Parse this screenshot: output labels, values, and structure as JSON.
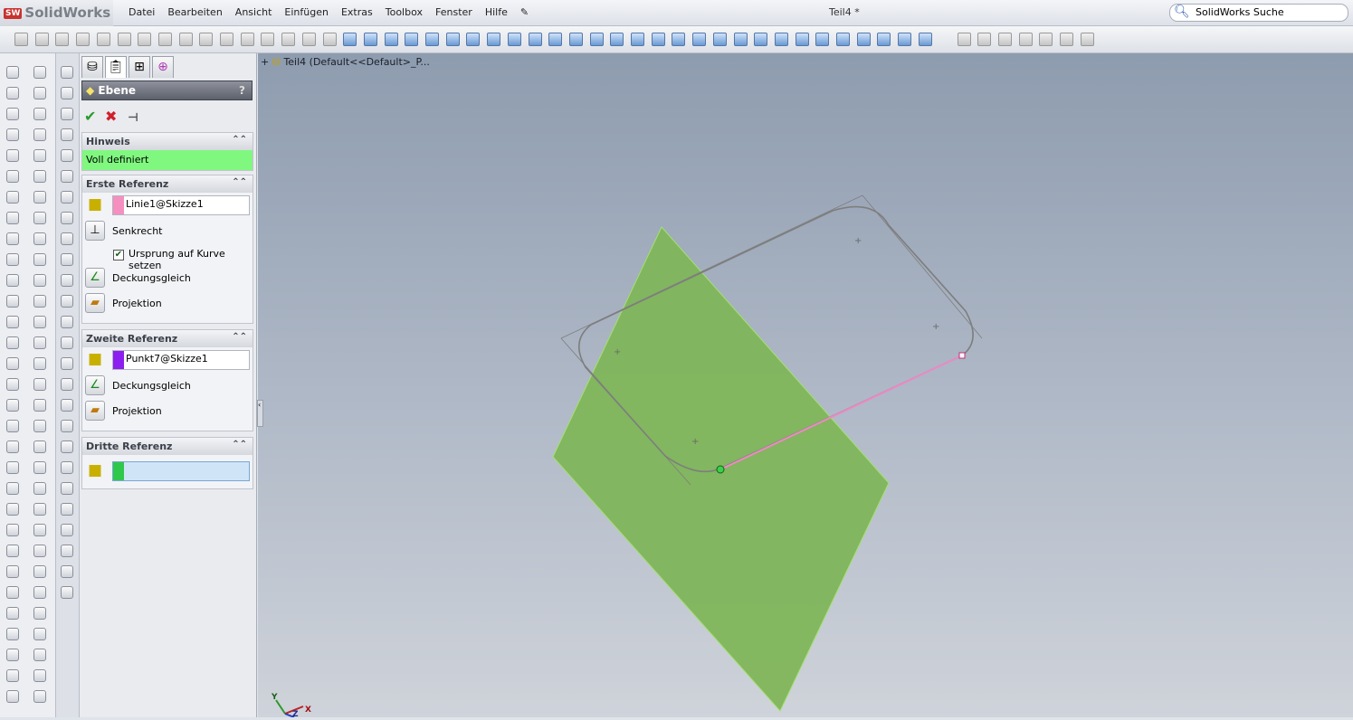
{
  "app": {
    "logo": "SolidWorks",
    "document_title": "Teil4 *",
    "search_placeholder": "SolidWorks Suche"
  },
  "menu": [
    "Datei",
    "Bearbeiten",
    "Ansicht",
    "Einfügen",
    "Extras",
    "Toolbox",
    "Fenster",
    "Hilfe"
  ],
  "tree": {
    "expander": "+",
    "root": "Teil4  (Default<<Default>_P..."
  },
  "property_manager": {
    "title": "Ebene",
    "help": "?",
    "ok": "✔",
    "cancel": "✖",
    "pin": "⊣",
    "hint": {
      "header": "Hinweis",
      "text": "Voll definiert",
      "color": "#80f880"
    },
    "first": {
      "header": "Erste Referenz",
      "value": "Linie1@Skizze1",
      "swatch": "#f58fc0",
      "option1": "Senkrecht",
      "checkbox": "Ursprung auf Kurve setzen",
      "checked": true,
      "option2": "Deckungsgleich",
      "option3": "Projektion"
    },
    "second": {
      "header": "Zweite Referenz",
      "value": "Punkt7@Skizze1",
      "swatch": "#8c1ef0",
      "option1": "Deckungsgleich",
      "option2": "Projektion"
    },
    "third": {
      "header": "Dritte Referenz",
      "value": "",
      "swatch": "#2fc84a"
    }
  },
  "triad": {
    "x": "X",
    "y": "Y",
    "z": "Z"
  },
  "colors": {
    "plane": "#7fb55a",
    "sketch": "#7e7e7e",
    "line": "#ef88c4"
  }
}
